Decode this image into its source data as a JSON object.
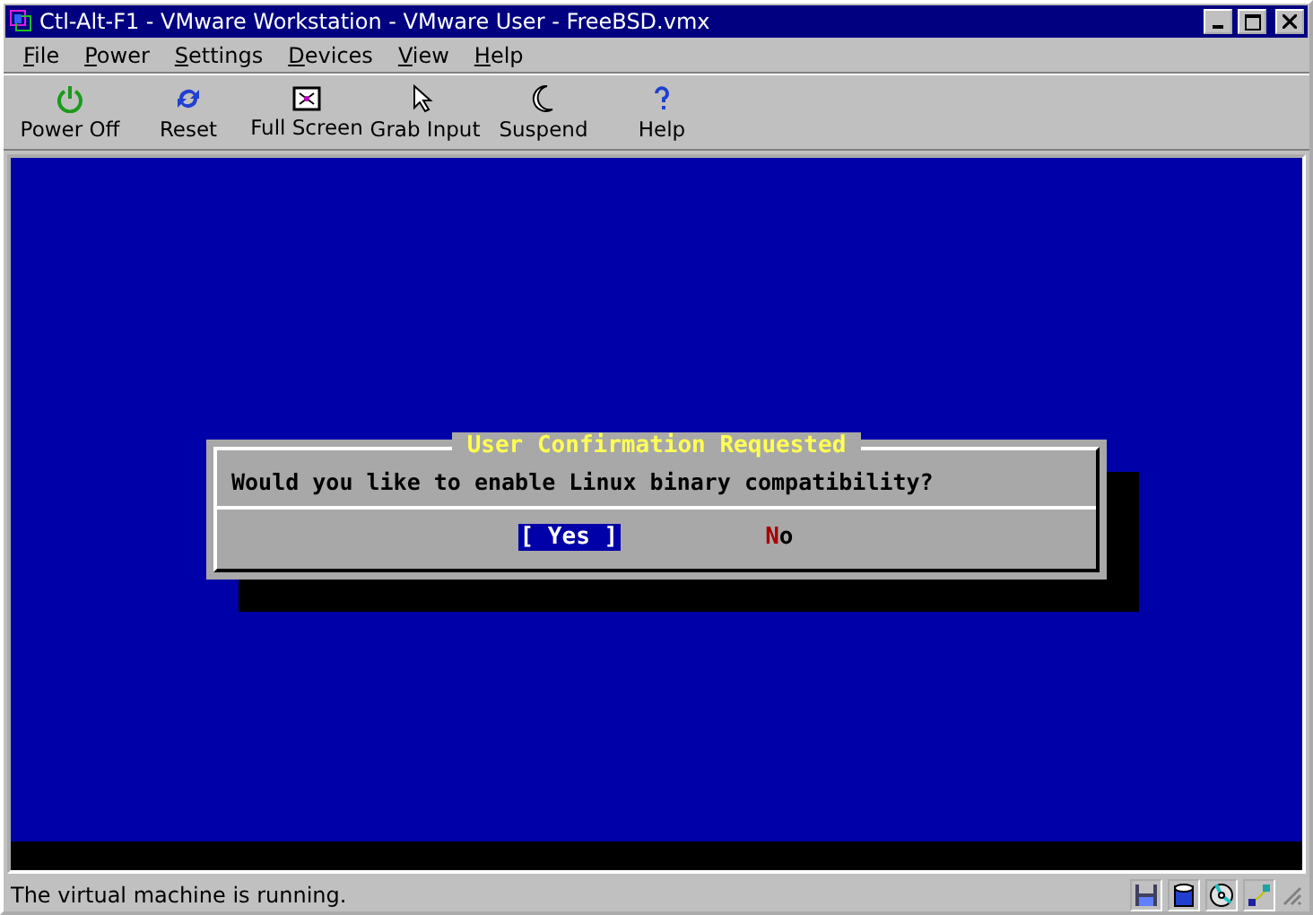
{
  "window": {
    "title": "Ctl-Alt-F1 - VMware Workstation - VMware User - FreeBSD.vmx"
  },
  "menu": [
    "File",
    "Power",
    "Settings",
    "Devices",
    "View",
    "Help"
  ],
  "toolbar": [
    {
      "kind": "power",
      "label": "Power Off"
    },
    {
      "kind": "reset",
      "label": "Reset"
    },
    {
      "kind": "fullscreen",
      "label": "Full Screen"
    },
    {
      "kind": "grab",
      "label": "Grab Input"
    },
    {
      "kind": "suspend",
      "label": "Suspend"
    },
    {
      "kind": "help",
      "label": "Help"
    }
  ],
  "dialog": {
    "title": "User Confirmation Requested",
    "message": "Would you like to enable Linux binary compatibility?",
    "buttons": [
      {
        "label": "[ Yes ]",
        "selected": true
      },
      {
        "label": "No",
        "selected": false
      }
    ]
  },
  "status_bar": {
    "text": "The virtual machine is running."
  }
}
